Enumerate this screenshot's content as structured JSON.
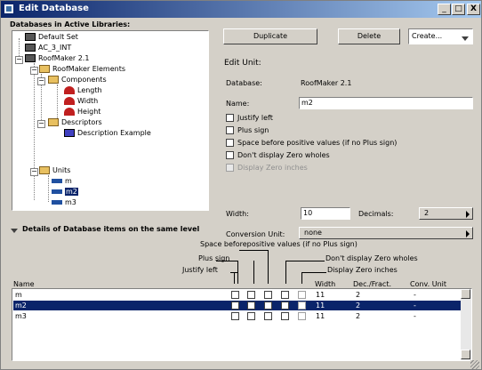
{
  "window": {
    "title": "Edit Database",
    "controls": [
      "_",
      "□",
      "X"
    ]
  },
  "tree_panel": {
    "header": "Databases in Active Libraries:",
    "nodes": [
      "Default Set",
      "AC_3_INT",
      "RoofMaker 2.1",
      "RoofMaker Elements",
      "Components",
      "Length",
      "Width",
      "Height",
      "Descriptors",
      "Description Example",
      "Units",
      "m",
      "m2",
      "m3"
    ]
  },
  "buttons": {
    "duplicate": "Duplicate",
    "delete": "Delete",
    "create": "Create..."
  },
  "edit_unit": {
    "heading": "Edit Unit:",
    "database_label": "Database:",
    "database_value": "RoofMaker 2.1",
    "name_label": "Name:",
    "name_value": "m2",
    "options": [
      "Justify left",
      "Plus sign",
      "Space before positive values (if no Plus sign)",
      "Don't display Zero wholes",
      "Display Zero inches"
    ],
    "width_label": "Width:",
    "width_value": "10",
    "decimals_label": "Decimals:",
    "decimals_value": "2",
    "conversion_label": "Conversion Unit:",
    "conversion_value": "none"
  },
  "details": {
    "heading": "Details of Database items on the same level",
    "col_headers": {
      "space": "Space beforepositive values (if no Plus sign)",
      "plus": "Plus sign",
      "justify": "Justify left",
      "zero_wholes": "Don't display Zero wholes",
      "zero_inches": "Display Zero inches",
      "name": "Name",
      "width": "Width",
      "dec": "Dec./Fract.",
      "conv": "Conv. Unit"
    },
    "rows": [
      {
        "name": "m",
        "width": "11",
        "dec": "2",
        "conv": "-"
      },
      {
        "name": "m2",
        "width": "11",
        "dec": "2",
        "conv": "-"
      },
      {
        "name": "m3",
        "width": "11",
        "dec": "2",
        "conv": "-"
      }
    ],
    "selected_row": 1
  },
  "colors": {
    "title_active": "#0a246a",
    "selection": "#0a246a",
    "face": "#d4d0c8"
  },
  "icons": [
    "database-icon",
    "folder-icon",
    "unit-icon",
    "description-icon",
    "expand-icon",
    "collapse-icon"
  ]
}
